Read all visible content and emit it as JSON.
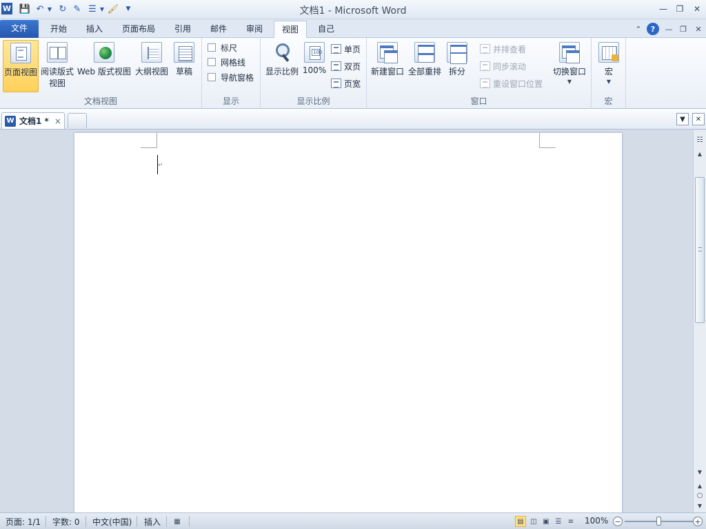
{
  "window": {
    "title": "文档1 - Microsoft Word",
    "quick_access": [
      "word-logo-icon",
      "save-icon",
      "undo-icon",
      "redo-icon",
      "edit-icon",
      "list-icon",
      "format-painter-icon",
      "customize-icon"
    ]
  },
  "tabs": [
    {
      "label": "文件",
      "file": true
    },
    {
      "label": "开始"
    },
    {
      "label": "插入"
    },
    {
      "label": "页面布局"
    },
    {
      "label": "引用"
    },
    {
      "label": "邮件"
    },
    {
      "label": "审阅"
    },
    {
      "label": "视图",
      "active": true
    },
    {
      "label": "自己"
    }
  ],
  "ribbon": {
    "doc_views": {
      "label": "文档视图",
      "print_layout": "页面视图",
      "reading_line1": "阅读版式",
      "reading_line2": "视图",
      "web_layout": "Web 版式视图",
      "outline": "大纲视图",
      "draft": "草稿"
    },
    "show": {
      "label": "显示",
      "ruler": "标尺",
      "gridlines": "网格线",
      "nav_pane": "导航窗格"
    },
    "zoom": {
      "label": "显示比例",
      "zoom": "显示比例",
      "hundred": "100%",
      "one_page": "单页",
      "two_pages": "双页",
      "page_width": "页宽"
    },
    "window": {
      "label": "窗口",
      "new_window": "新建窗口",
      "arrange_all": "全部重排",
      "split": "拆分",
      "side_by_side": "并排查看",
      "sync_scroll": "同步滚动",
      "reset_position": "重设窗口位置",
      "switch_windows": "切换窗口"
    },
    "macros": {
      "label": "宏",
      "macros": "宏"
    }
  },
  "doc_tab": {
    "name": "文档1 *",
    "close": "×"
  },
  "status": {
    "page": "页面: 1/1",
    "words": "字数: 0",
    "language": "中文(中国)",
    "mode": "插入",
    "zoom": "100%",
    "zoom_level": 1.0
  }
}
